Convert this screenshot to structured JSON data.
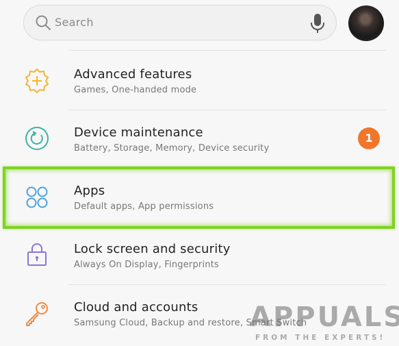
{
  "search": {
    "placeholder": "Search",
    "icon": "search-icon",
    "mic_icon": "microphone-icon"
  },
  "settings": [
    {
      "title": "Advanced features",
      "subtitle": "Games, One-handed mode",
      "icon": "advanced-features-icon",
      "icon_color": "#f2b535"
    },
    {
      "title": "Device maintenance",
      "subtitle": "Battery, Storage, Memory, Device security",
      "icon": "device-maintenance-icon",
      "icon_color": "#3bb3a1",
      "badge": "1",
      "badge_color": "#f0762b"
    },
    {
      "title": "Apps",
      "subtitle": "Default apps, App permissions",
      "icon": "apps-icon",
      "icon_color": "#4aa3df",
      "highlighted": true
    },
    {
      "title": "Lock screen and security",
      "subtitle": "Always On Display, Fingerprints",
      "icon": "lock-icon",
      "icon_color": "#8c74d9"
    },
    {
      "title": "Cloud and accounts",
      "subtitle": "Samsung Cloud, Backup and restore, Smart Switch",
      "icon": "key-icon",
      "icon_color": "#ee8a4a"
    }
  ],
  "watermark": {
    "main": "APPUALS",
    "sub": "FROM THE EXPERTS!"
  },
  "highlight_color": "#7ed321"
}
